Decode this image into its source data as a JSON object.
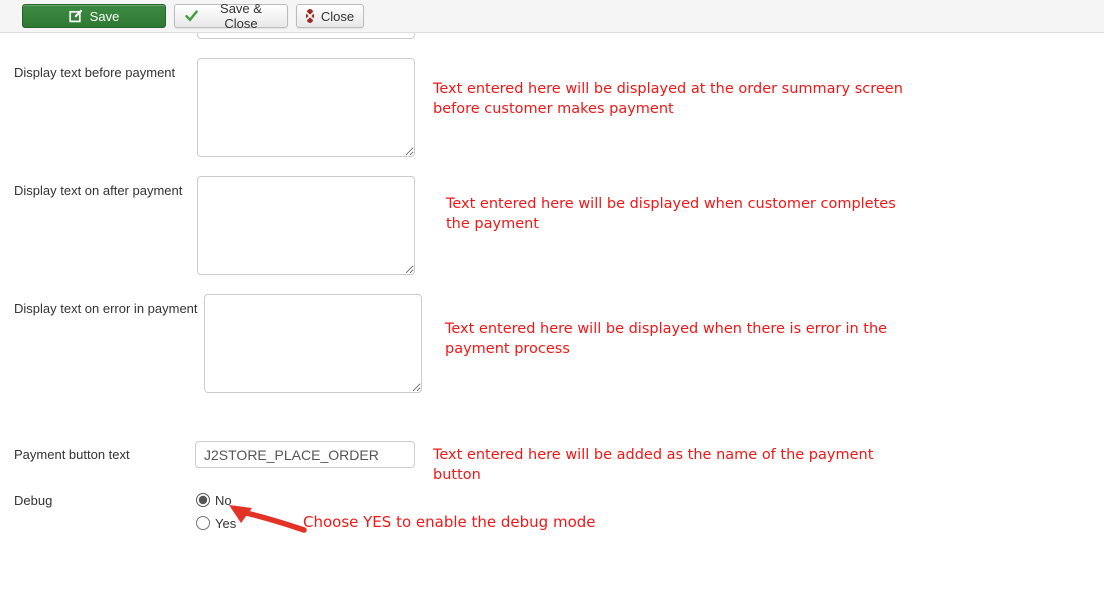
{
  "toolbar": {
    "save_label": "Save",
    "save_close_label": "Save & Close",
    "close_label": "Close"
  },
  "colors": {
    "save_button_green": "#2f7a33",
    "check_green": "#3f9c3f",
    "close_badge_red": "#9c2a21",
    "annotation_red": "#f21717",
    "arrow_red": "#e33327"
  },
  "fields": {
    "before_payment": {
      "label": "Display text before payment",
      "value": "",
      "note_line1": "Text entered here will be displayed at the order summary screen",
      "note_line2": "before customer makes payment"
    },
    "after_payment": {
      "label": "Display text on after payment",
      "value": "",
      "note_line1": "Text entered here will be displayed when customer completes",
      "note_line2": "the payment"
    },
    "error_payment": {
      "label": "Display text on error in payment",
      "value": "",
      "note_line1": "Text entered here will be displayed when there is error in the",
      "note_line2": "payment process"
    },
    "button_text": {
      "label": "Payment button text",
      "value": "J2STORE_PLACE_ORDER",
      "note_line1": "Text entered here will be added as the name of the payment",
      "note_line2": "button"
    },
    "debug": {
      "label": "Debug",
      "options": [
        {
          "label": "No",
          "checked_attr": "checked"
        },
        {
          "label": "Yes"
        }
      ],
      "note": "Choose YES to enable the debug mode"
    }
  }
}
